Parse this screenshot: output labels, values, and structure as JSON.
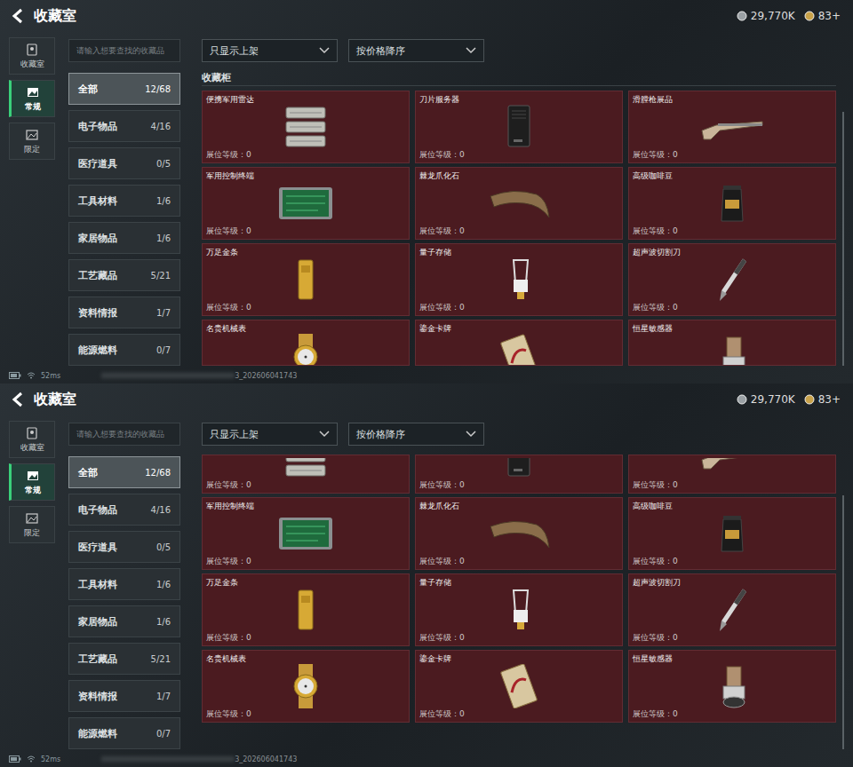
{
  "panels": [
    {
      "title": "收藏室",
      "currencies": [
        {
          "value": "29,770K"
        },
        {
          "value": "83+"
        }
      ],
      "nav": [
        {
          "label": "收藏室",
          "selected": false
        },
        {
          "label": "常规",
          "selected": true
        },
        {
          "label": "限定",
          "selected": false
        }
      ],
      "search": {
        "placeholder": "请输入想要查找的收藏品"
      },
      "filters": [
        "只显示上架",
        "按价格降序"
      ],
      "categories": [
        {
          "label": "全部",
          "count": "12/68",
          "selected": true
        },
        {
          "label": "电子物品",
          "count": "4/16",
          "selected": false
        },
        {
          "label": "医疗道具",
          "count": "0/5",
          "selected": false
        },
        {
          "label": "工具材料",
          "count": "1/6",
          "selected": false
        },
        {
          "label": "家居物品",
          "count": "1/6",
          "selected": false
        },
        {
          "label": "工艺藏品",
          "count": "5/21",
          "selected": false
        },
        {
          "label": "资料情报",
          "count": "1/7",
          "selected": false
        },
        {
          "label": "能源燃料",
          "count": "0/7",
          "selected": false
        }
      ],
      "section_title": "收藏柜",
      "items": [
        {
          "kind": "full",
          "name": "便携军用雷达",
          "level": "展位等级：0"
        },
        {
          "kind": "full",
          "name": "刀片服务器",
          "level": "展位等级：0"
        },
        {
          "kind": "full",
          "name": "滑膛枪展品",
          "level": "展位等级：0"
        },
        {
          "kind": "full",
          "name": "军用控制终端",
          "level": "展位等级：0"
        },
        {
          "kind": "full",
          "name": "棘龙爪化石",
          "level": "展位等级：0"
        },
        {
          "kind": "full",
          "name": "高级咖啡豆",
          "level": "展位等级：0"
        },
        {
          "kind": "full",
          "name": "万足金条",
          "level": "展位等级：0"
        },
        {
          "kind": "full",
          "name": "量子存储",
          "level": "展位等级：0"
        },
        {
          "kind": "full",
          "name": "超声波切割刀",
          "level": "展位等级：0"
        },
        {
          "kind": "cut-bottom",
          "name": "名贵机械表"
        },
        {
          "kind": "cut-bottom",
          "name": "鎏金卡牌"
        },
        {
          "kind": "cut-bottom",
          "name": "恒星敏感器"
        }
      ],
      "status": {
        "ping": "52ms",
        "id": "3_202606041743"
      }
    },
    {
      "title": "收藏室",
      "currencies": [
        {
          "value": "29,770K"
        },
        {
          "value": "83+"
        }
      ],
      "nav": [
        {
          "label": "收藏室",
          "selected": false
        },
        {
          "label": "常规",
          "selected": true
        },
        {
          "label": "限定",
          "selected": false
        }
      ],
      "search": {
        "placeholder": "请输入想要查找的收藏品"
      },
      "filters": [
        "只显示上架",
        "按价格降序"
      ],
      "categories": [
        {
          "label": "全部",
          "count": "12/68",
          "selected": true
        },
        {
          "label": "电子物品",
          "count": "4/16",
          "selected": false
        },
        {
          "label": "医疗道具",
          "count": "0/5",
          "selected": false
        },
        {
          "label": "工具材料",
          "count": "1/6",
          "selected": false
        },
        {
          "label": "家居物品",
          "count": "1/6",
          "selected": false
        },
        {
          "label": "工艺藏品",
          "count": "5/21",
          "selected": false
        },
        {
          "label": "资料情报",
          "count": "1/7",
          "selected": false
        },
        {
          "label": "能源燃料",
          "count": "0/7",
          "selected": false
        }
      ],
      "items": [
        {
          "kind": "cut-top",
          "level": "展位等级：0"
        },
        {
          "kind": "cut-top",
          "level": "展位等级：0"
        },
        {
          "kind": "cut-top",
          "level": "展位等级：0"
        },
        {
          "kind": "full",
          "name": "军用控制终端",
          "level": "展位等级：0"
        },
        {
          "kind": "full",
          "name": "棘龙爪化石",
          "level": "展位等级：0"
        },
        {
          "kind": "full",
          "name": "高级咖啡豆",
          "level": "展位等级：0"
        },
        {
          "kind": "full",
          "name": "万足金条",
          "level": "展位等级：0"
        },
        {
          "kind": "full",
          "name": "量子存储",
          "level": "展位等级：0"
        },
        {
          "kind": "full",
          "name": "超声波切割刀",
          "level": "展位等级：0"
        },
        {
          "kind": "full",
          "name": "名贵机械表",
          "level": "展位等级：0"
        },
        {
          "kind": "full",
          "name": "鎏金卡牌",
          "level": "展位等级：0"
        },
        {
          "kind": "full",
          "name": "恒星敏感器",
          "level": "展位等级：0"
        }
      ],
      "status": {
        "ping": "52ms",
        "id": "3_202606041743"
      }
    }
  ]
}
